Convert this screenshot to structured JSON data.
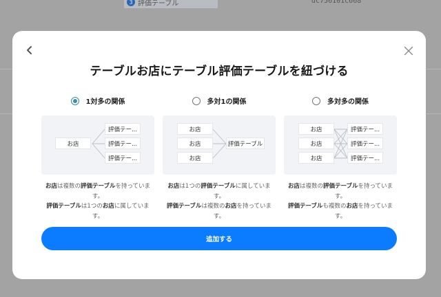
{
  "background": {
    "chip_number": "3",
    "chip_label": "評価テーブル",
    "code_text": "dc756101c668"
  },
  "modal": {
    "title": "テーブルお店にテーブル評価テーブルを紐づける",
    "options": [
      {
        "label": "1対多の関係",
        "selected": true,
        "left_boxes": [
          "お店"
        ],
        "right_boxes": [
          "評価テー...",
          "評価テー...",
          "評価テー..."
        ],
        "desc_line1": [
          "お店",
          "は複数の",
          "評価テーブル",
          "を持っていま",
          "す。"
        ],
        "desc_line2": [
          "評価テーブル",
          "は1つの",
          "お店",
          "に属していま",
          "す。"
        ]
      },
      {
        "label": "多対1の関係",
        "selected": false,
        "left_boxes": [
          "お店",
          "お店",
          "お店"
        ],
        "right_boxes": [
          "評価テーブル"
        ],
        "desc_line1": [
          "お店",
          "は1つの",
          "評価テーブル",
          "に属していま",
          "す。"
        ],
        "desc_line2": [
          "評価テーブル",
          "は複数の",
          "お店",
          "を持っていま",
          "す。"
        ]
      },
      {
        "label": "多対多の関係",
        "selected": false,
        "left_boxes": [
          "お店",
          "お店",
          "お店"
        ],
        "right_boxes": [
          "評価テー...",
          "評価テー...",
          "評価テー..."
        ],
        "desc_line1": [
          "お店",
          "は複数の",
          "評価テーブル",
          "を持っていま",
          "す。"
        ],
        "desc_line2": [
          "評価テーブル",
          "も複数の",
          "お店",
          "を持っていま",
          "す。"
        ]
      }
    ],
    "add_button_label": "追加する"
  },
  "colors": {
    "accent": "#0b7bff",
    "radio_selected": "#3a8fa3"
  }
}
